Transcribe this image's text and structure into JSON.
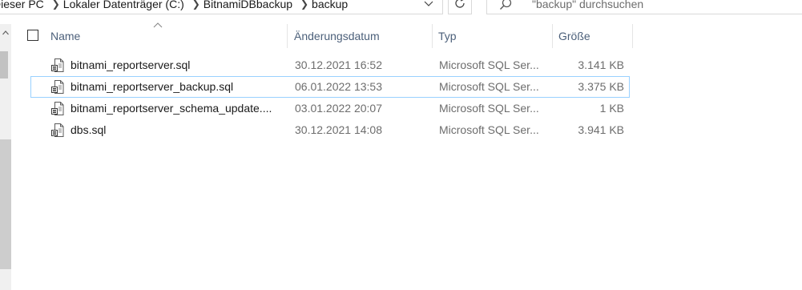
{
  "address_bar": {
    "crumbs": [
      "Dieser PC",
      "Lokaler Datenträger (C:)",
      "BitnamiDBbackup",
      "backup"
    ]
  },
  "search": {
    "placeholder": "\"backup\" durchsuchen"
  },
  "columns": {
    "name": "Name",
    "date": "Änderungsdatum",
    "type": "Typ",
    "size": "Größe"
  },
  "files": [
    {
      "name": "bitnami_reportserver.sql",
      "date": "30.12.2021 16:52",
      "type": "Microsoft SQL Ser...",
      "size": "3.141 KB"
    },
    {
      "name": "bitnami_reportserver_backup.sql",
      "date": "06.01.2022 13:53",
      "type": "Microsoft SQL Ser...",
      "size": "3.375 KB"
    },
    {
      "name": "bitnami_reportserver_schema_update....",
      "date": "03.01.2022 20:07",
      "type": "Microsoft SQL Ser...",
      "size": "1 KB"
    },
    {
      "name": "dbs.sql",
      "date": "30.12.2021 14:08",
      "type": "Microsoft SQL Ser...",
      "size": "3.941 KB"
    }
  ],
  "icons": {
    "file": "sql-file-icon",
    "search": "search-icon",
    "refresh": "refresh-icon",
    "dropdown": "chevron-down-icon",
    "sort": "sort-up-icon"
  },
  "colors": {
    "header_text": "#4c607a",
    "focus_border": "#99d1ff",
    "secondary_text": "#6d6d6d"
  }
}
